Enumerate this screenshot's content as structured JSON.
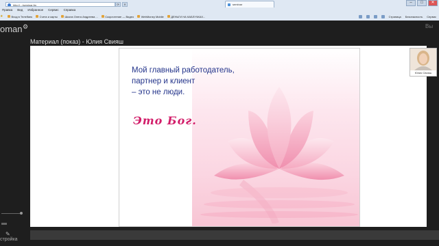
{
  "browser": {
    "address": "http://.../seminar.fm",
    "tab_title": "seminar",
    "menu": [
      "Правка",
      "Вид",
      "Избранное",
      "Сервис",
      "Справка"
    ],
    "favorites": [
      "Вход в Телебанк",
      "Счета и карты",
      "Школа Олега Андреева ...",
      "Скорочтение — Видео",
      "WebMoney Mobile",
      "ДЕНЬГИ НА КАБЛУЧКАХ..."
    ],
    "commands": [
      "Страница",
      "Безопасность",
      "Сервис"
    ]
  },
  "app": {
    "brand": "oman",
    "right_hint": "Вы",
    "pod_title": "Материал (показ) - Юлия Свияш",
    "slide": {
      "quote_lines": [
        "Мой главный работодатель,",
        "партнер и клиент",
        "– это не люди."
      ],
      "emphasis": "Это Бог."
    },
    "webcam_name": "Юлия Свияш",
    "setup_label": "стройка"
  },
  "colors": {
    "quote": "#22338a",
    "emphasis": "#d21e6a",
    "app_bg": "#1e1e1e"
  }
}
